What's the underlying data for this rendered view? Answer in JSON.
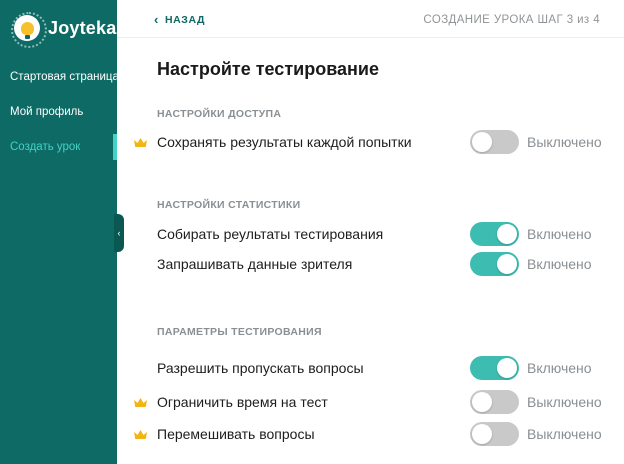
{
  "brand": {
    "name": "Joyteka"
  },
  "nav": {
    "items": [
      {
        "label": "Стартовая страница"
      },
      {
        "label": "Мой профиль"
      },
      {
        "label": "Создать урок"
      }
    ]
  },
  "header": {
    "back_label": "НАЗАД",
    "step_label": "СОЗДАНИЕ УРОКА ШАГ 3 из 4"
  },
  "main": {
    "title": "Настройте тестирование",
    "sections": [
      {
        "heading": "НАСТРОЙКИ ДОСТУПА",
        "settings": [
          {
            "label": "Сохранять результаты каждой попытки",
            "status": "Выключено",
            "enabled": false,
            "premium": true
          }
        ]
      },
      {
        "heading": "НАСТРОЙКИ СТАТИСТИКИ",
        "settings": [
          {
            "label": "Собирать реультаты тестирования",
            "status": "Включено",
            "enabled": true,
            "premium": false
          },
          {
            "label": "Запрашивать данные зрителя",
            "status": "Включено",
            "enabled": true,
            "premium": false
          }
        ]
      },
      {
        "heading": "ПАРАМЕТРЫ ТЕСТИРОВАНИЯ",
        "settings": [
          {
            "label": "Разрешить пропускать вопросы",
            "status": "Включено",
            "enabled": true,
            "premium": false
          },
          {
            "label": "Ограничить время на тест",
            "status": "Выключено",
            "enabled": false,
            "premium": true
          },
          {
            "label": "Перемешивать вопросы",
            "status": "Выключено",
            "enabled": false,
            "premium": true
          }
        ]
      }
    ]
  },
  "colors": {
    "sidebar_bg": "#0e6a64",
    "accent": "#3dbdb1",
    "active_nav": "#45d1c4",
    "toggle_off": "#c9c9c9",
    "crown": "#f2b516"
  },
  "icons": {
    "logo": "lightbulb-icon",
    "back": "chevron-left-icon",
    "collapse": "chevron-left-icon",
    "premium": "crown-icon"
  }
}
